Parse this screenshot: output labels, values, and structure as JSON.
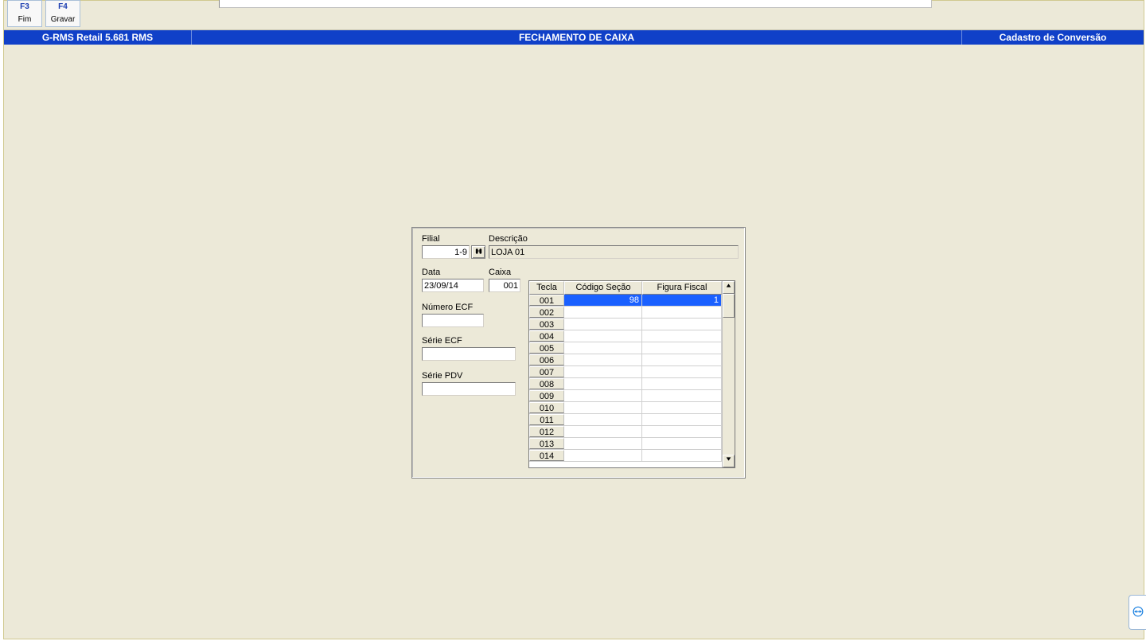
{
  "toolbar": {
    "buttons": [
      {
        "key": "F3",
        "label": "Fim"
      },
      {
        "key": "F4",
        "label": "Gravar"
      }
    ]
  },
  "titlebar": {
    "left": "G-RMS Retail 5.681 RMS",
    "center": "FECHAMENTO DE CAIXA",
    "right": "Cadastro de Conversão"
  },
  "form": {
    "filial_label": "Filial",
    "filial_value": "1-9",
    "descricao_label": "Descrição",
    "descricao_value": "LOJA 01",
    "data_label": "Data",
    "data_value": "23/09/14",
    "caixa_label": "Caixa",
    "caixa_value": "001",
    "numero_ecf_label": "Número ECF",
    "numero_ecf_value": "",
    "serie_ecf_label": "Série ECF",
    "serie_ecf_value": "",
    "serie_pdv_label": "Série PDV",
    "serie_pdv_value": ""
  },
  "grid": {
    "headers": [
      "Tecla",
      "Código Seção",
      "Figura Fiscal"
    ],
    "rows": [
      {
        "tecla": "001",
        "codigo": "98",
        "figura": "1",
        "selected": true
      },
      {
        "tecla": "002",
        "codigo": "",
        "figura": ""
      },
      {
        "tecla": "003",
        "codigo": "",
        "figura": ""
      },
      {
        "tecla": "004",
        "codigo": "",
        "figura": ""
      },
      {
        "tecla": "005",
        "codigo": "",
        "figura": ""
      },
      {
        "tecla": "006",
        "codigo": "",
        "figura": ""
      },
      {
        "tecla": "007",
        "codigo": "",
        "figura": ""
      },
      {
        "tecla": "008",
        "codigo": "",
        "figura": ""
      },
      {
        "tecla": "009",
        "codigo": "",
        "figura": ""
      },
      {
        "tecla": "010",
        "codigo": "",
        "figura": ""
      },
      {
        "tecla": "011",
        "codigo": "",
        "figura": ""
      },
      {
        "tecla": "012",
        "codigo": "",
        "figura": ""
      },
      {
        "tecla": "013",
        "codigo": "",
        "figura": ""
      },
      {
        "tecla": "014",
        "codigo": "",
        "figura": ""
      }
    ]
  }
}
